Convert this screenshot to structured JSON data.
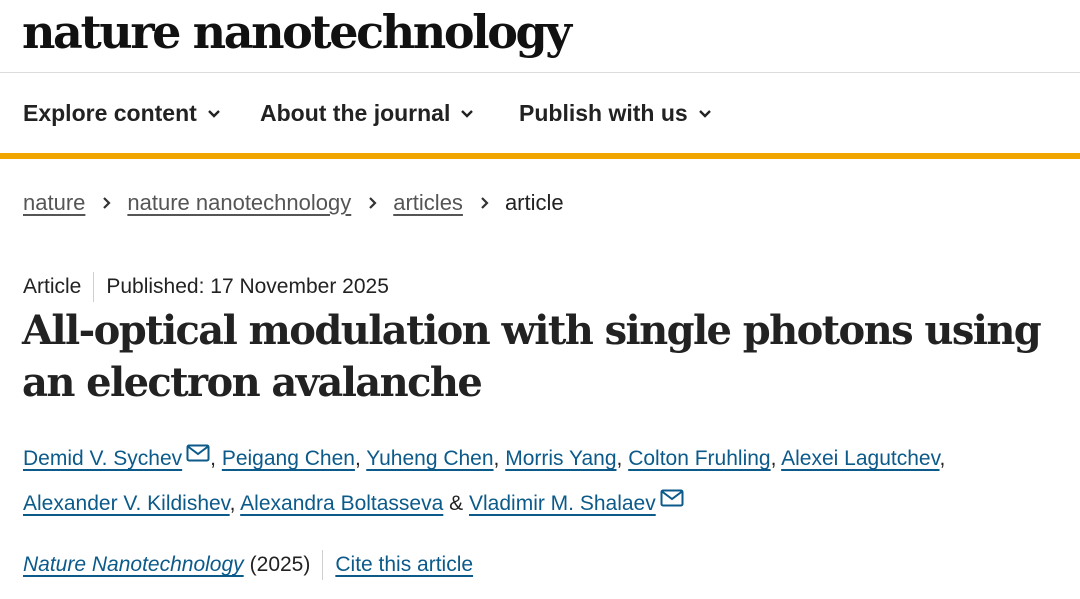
{
  "site": {
    "logo": "nature nanotechnology"
  },
  "nav": {
    "items": [
      {
        "label": "Explore content",
        "icon": "chevron-down-icon"
      },
      {
        "label": "About the journal",
        "icon": "chevron-down-icon"
      },
      {
        "label": "Publish with us",
        "icon": "chevron-down-icon"
      }
    ],
    "accent_color": "#f0a500"
  },
  "breadcrumb": {
    "items": [
      "nature",
      "nature nanotechnology",
      "articles"
    ],
    "current": "article"
  },
  "article": {
    "type": "Article",
    "published": "Published: 17 November 2025",
    "title": "All-optical modulation with single photons using an electron avalanche",
    "authors": [
      "Demid V. Sychev",
      "Peigang Chen",
      "Yuheng Chen",
      "Morris Yang",
      "Colton Fruhling",
      "Alexei Lagutchev",
      "Alexander V. Kildishev",
      "Alexandra Boltasseva",
      "Vladimir M. Shalaev"
    ],
    "comma": ",",
    "ampersand": "&",
    "journal": "Nature Nanotechnology",
    "year": "(2025)",
    "cite_label": "Cite this article",
    "link_color": "#0b5a8a"
  }
}
